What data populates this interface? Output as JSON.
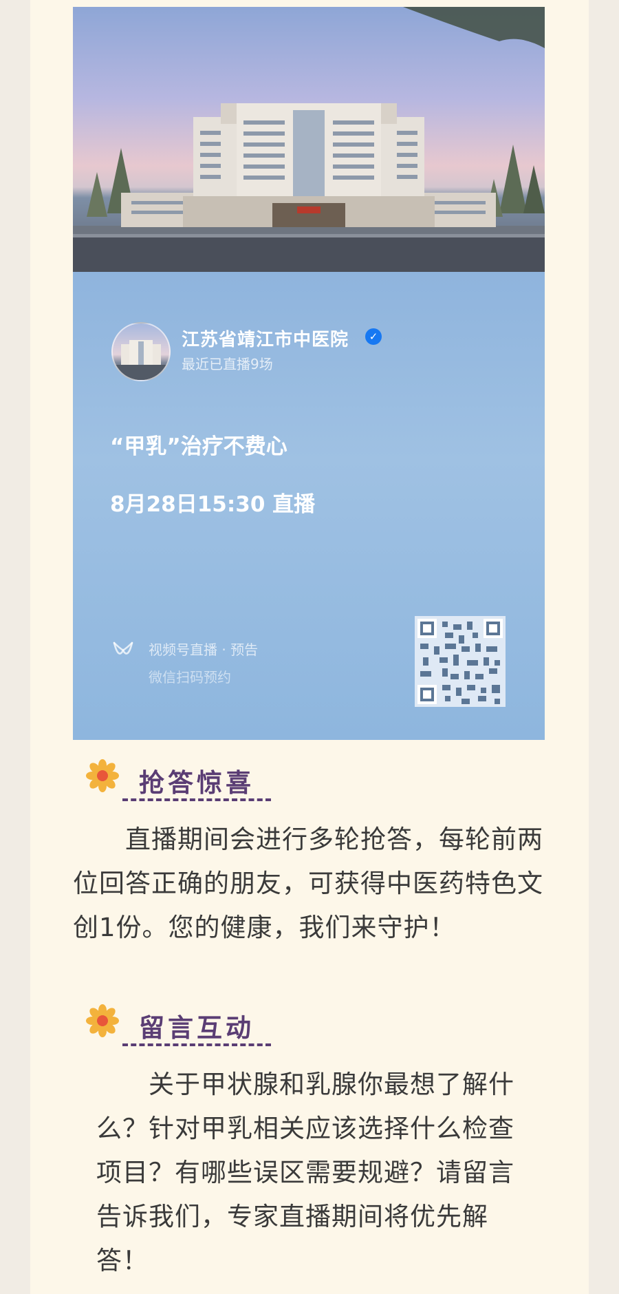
{
  "live_card": {
    "account_name": "江苏省靖江市中医院",
    "account_subtitle": "最近已直播9场",
    "title": "“甲乳”治疗不费心",
    "schedule": "8月28日15:30 直播",
    "channel_label": "视频号直播 · 预告",
    "scan_hint": "微信扫码预约",
    "verified_icon": "check-badge-icon",
    "accent_color": "#1778f2"
  },
  "sections": [
    {
      "title": "抢答惊喜",
      "icon": "flower-icon",
      "body": "　　直播期间会进行多轮抢答，每轮前两位回答正确的朋友，可获得中医药特色文创1份。您的健康，我们来守护！"
    },
    {
      "title": "留言互动",
      "icon": "flower-icon",
      "body": "　　关于甲状腺和乳腺你最想了解什么？针对甲乳相关应该选择什么检查项目？有哪些误区需要规避？请留言告诉我们，专家直播期间将优先解答！"
    }
  ],
  "colors": {
    "page_background": "#fdf7e9",
    "heading": "#5a3d74",
    "card_background": "#8fb6df"
  }
}
